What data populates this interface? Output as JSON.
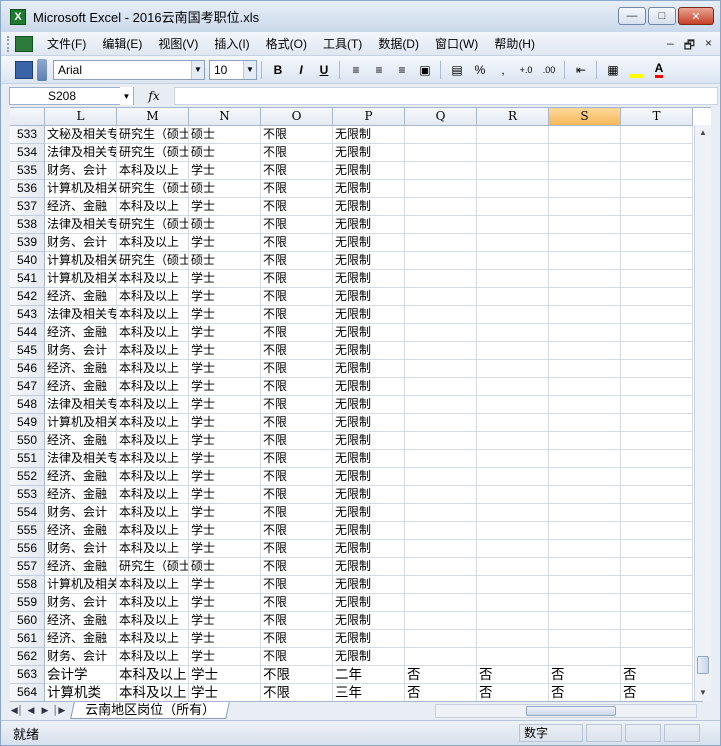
{
  "window": {
    "app_icon": "excel-icon",
    "title": "Microsoft Excel - 2016云南国考职位.xls",
    "controls": [
      "minimize",
      "maximize",
      "close"
    ]
  },
  "menu": {
    "items": [
      "文件(F)",
      "编辑(E)",
      "视图(V)",
      "插入(I)",
      "格式(O)",
      "工具(T)",
      "数据(D)",
      "窗口(W)",
      "帮助(H)"
    ],
    "doc_controls": [
      "–",
      "🗗",
      "×"
    ]
  },
  "toolbar": {
    "font_name": "Arial",
    "font_size": "10",
    "bold": "B",
    "italic": "I",
    "underline": "U",
    "percent": "%",
    "comma": ",",
    "inc_decimal": "+.0",
    "dec_decimal": ".00",
    "fill_color": "#ffff00",
    "font_color": "#ff0000"
  },
  "formula_bar": {
    "name_box": "S208",
    "fx": "fx",
    "formula": ""
  },
  "columns": [
    "L",
    "M",
    "N",
    "O",
    "P",
    "Q",
    "R",
    "S",
    "T"
  ],
  "selected_column": "S",
  "rows": [
    {
      "num": "533",
      "cells": [
        "文秘及相关专业",
        "研究生（硕士）",
        "硕士",
        "不限",
        "无限制",
        "",
        "",
        "",
        ""
      ]
    },
    {
      "num": "534",
      "cells": [
        "法律及相关专业",
        "研究生（硕士）",
        "硕士",
        "不限",
        "无限制",
        "",
        "",
        "",
        ""
      ]
    },
    {
      "num": "535",
      "cells": [
        "财务、会计",
        "本科及以上",
        "学士",
        "不限",
        "无限制",
        "",
        "",
        "",
        ""
      ]
    },
    {
      "num": "536",
      "cells": [
        "计算机及相关",
        "研究生（硕士）",
        "硕士",
        "不限",
        "无限制",
        "",
        "",
        "",
        ""
      ]
    },
    {
      "num": "537",
      "cells": [
        "经济、金融",
        "本科及以上",
        "学士",
        "不限",
        "无限制",
        "",
        "",
        "",
        ""
      ]
    },
    {
      "num": "538",
      "cells": [
        "法律及相关专业",
        "研究生（硕士）",
        "硕士",
        "不限",
        "无限制",
        "",
        "",
        "",
        ""
      ]
    },
    {
      "num": "539",
      "cells": [
        "财务、会计",
        "本科及以上",
        "学士",
        "不限",
        "无限制",
        "",
        "",
        "",
        ""
      ]
    },
    {
      "num": "540",
      "cells": [
        "计算机及相关",
        "研究生（硕士）",
        "硕士",
        "不限",
        "无限制",
        "",
        "",
        "",
        ""
      ]
    },
    {
      "num": "541",
      "cells": [
        "计算机及相关",
        "本科及以上",
        "学士",
        "不限",
        "无限制",
        "",
        "",
        "",
        ""
      ]
    },
    {
      "num": "542",
      "cells": [
        "经济、金融",
        "本科及以上",
        "学士",
        "不限",
        "无限制",
        "",
        "",
        "",
        ""
      ]
    },
    {
      "num": "543",
      "cells": [
        "法律及相关专业",
        "本科及以上",
        "学士",
        "不限",
        "无限制",
        "",
        "",
        "",
        ""
      ]
    },
    {
      "num": "544",
      "cells": [
        "经济、金融",
        "本科及以上",
        "学士",
        "不限",
        "无限制",
        "",
        "",
        "",
        ""
      ]
    },
    {
      "num": "545",
      "cells": [
        "财务、会计",
        "本科及以上",
        "学士",
        "不限",
        "无限制",
        "",
        "",
        "",
        ""
      ]
    },
    {
      "num": "546",
      "cells": [
        "经济、金融",
        "本科及以上",
        "学士",
        "不限",
        "无限制",
        "",
        "",
        "",
        ""
      ]
    },
    {
      "num": "547",
      "cells": [
        "经济、金融",
        "本科及以上",
        "学士",
        "不限",
        "无限制",
        "",
        "",
        "",
        ""
      ]
    },
    {
      "num": "548",
      "cells": [
        "法律及相关专业",
        "本科及以上",
        "学士",
        "不限",
        "无限制",
        "",
        "",
        "",
        ""
      ]
    },
    {
      "num": "549",
      "cells": [
        "计算机及相关",
        "本科及以上",
        "学士",
        "不限",
        "无限制",
        "",
        "",
        "",
        ""
      ]
    },
    {
      "num": "550",
      "cells": [
        "经济、金融",
        "本科及以上",
        "学士",
        "不限",
        "无限制",
        "",
        "",
        "",
        ""
      ]
    },
    {
      "num": "551",
      "cells": [
        "法律及相关专业",
        "本科及以上",
        "学士",
        "不限",
        "无限制",
        "",
        "",
        "",
        ""
      ]
    },
    {
      "num": "552",
      "cells": [
        "经济、金融",
        "本科及以上",
        "学士",
        "不限",
        "无限制",
        "",
        "",
        "",
        ""
      ]
    },
    {
      "num": "553",
      "cells": [
        "经济、金融",
        "本科及以上",
        "学士",
        "不限",
        "无限制",
        "",
        "",
        "",
        ""
      ]
    },
    {
      "num": "554",
      "cells": [
        "财务、会计",
        "本科及以上",
        "学士",
        "不限",
        "无限制",
        "",
        "",
        "",
        ""
      ]
    },
    {
      "num": "555",
      "cells": [
        "经济、金融",
        "本科及以上",
        "学士",
        "不限",
        "无限制",
        "",
        "",
        "",
        ""
      ]
    },
    {
      "num": "556",
      "cells": [
        "财务、会计",
        "本科及以上",
        "学士",
        "不限",
        "无限制",
        "",
        "",
        "",
        ""
      ]
    },
    {
      "num": "557",
      "cells": [
        "经济、金融",
        "研究生（硕士）",
        "硕士",
        "不限",
        "无限制",
        "",
        "",
        "",
        ""
      ]
    },
    {
      "num": "558",
      "cells": [
        "计算机及相关",
        "本科及以上",
        "学士",
        "不限",
        "无限制",
        "",
        "",
        "",
        ""
      ]
    },
    {
      "num": "559",
      "cells": [
        "财务、会计",
        "本科及以上",
        "学士",
        "不限",
        "无限制",
        "",
        "",
        "",
        ""
      ]
    },
    {
      "num": "560",
      "cells": [
        "经济、金融",
        "本科及以上",
        "学士",
        "不限",
        "无限制",
        "",
        "",
        "",
        ""
      ]
    },
    {
      "num": "561",
      "cells": [
        "经济、金融",
        "本科及以上",
        "学士",
        "不限",
        "无限制",
        "",
        "",
        "",
        ""
      ]
    },
    {
      "num": "562",
      "cells": [
        "财务、会计",
        "本科及以上",
        "学士",
        "不限",
        "无限制",
        "",
        "",
        "",
        ""
      ]
    },
    {
      "num": "563",
      "cells": [
        "会计学",
        "本科及以上",
        "学士",
        "不限",
        "二年",
        "否",
        "否",
        "否",
        "否"
      ],
      "big": true
    },
    {
      "num": "564",
      "cells": [
        "计算机类",
        "本科及以上",
        "学士",
        "不限",
        "三年",
        "否",
        "否",
        "否",
        "否"
      ],
      "big": true
    }
  ],
  "sheet_tab": "云南地区岗位（所有）",
  "status": {
    "ready": "就绪",
    "num_lock": "数字"
  }
}
